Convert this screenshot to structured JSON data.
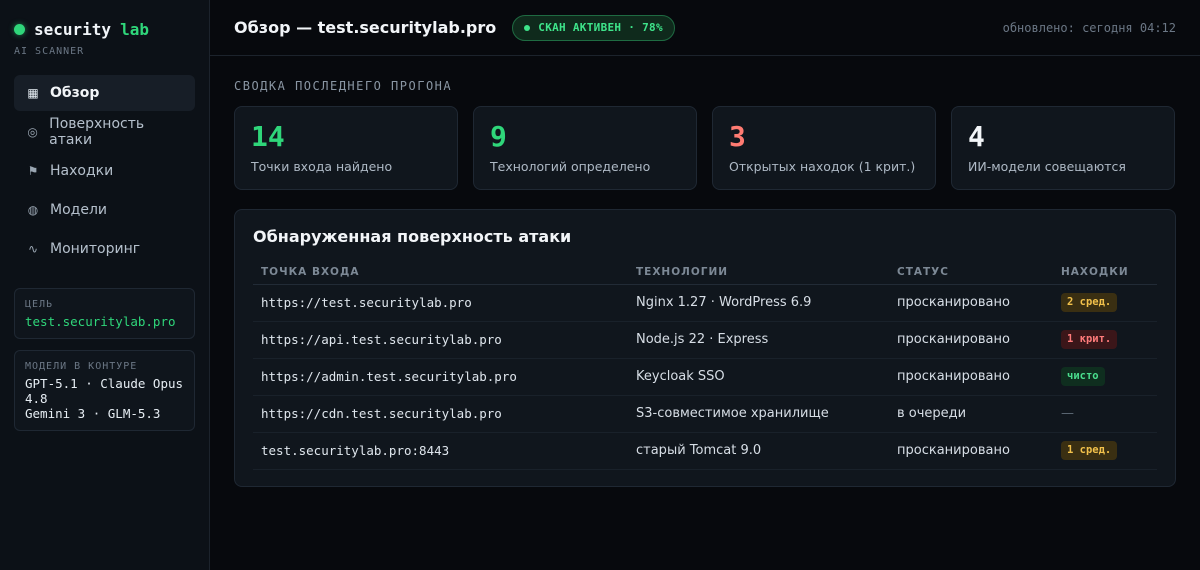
{
  "sidebar": {
    "brand_name": "security",
    "brand_accent": "lab",
    "brand_sub": "AI SCANNER",
    "nav": [
      {
        "label": "Обзор",
        "icon": "grid-icon",
        "active": true
      },
      {
        "label": "Поверхность атаки",
        "icon": "target-icon",
        "active": false
      },
      {
        "label": "Находки",
        "icon": "flag-icon",
        "active": false
      },
      {
        "label": "Модели",
        "icon": "globe-icon",
        "active": false
      },
      {
        "label": "Мониторинг",
        "icon": "pulse-icon",
        "active": false
      }
    ],
    "target_label": "ЦЕЛЬ",
    "target_value": "test.securitylab.pro",
    "models_label": "МОДЕЛИ В КОНТУРЕ",
    "models_line1": "GPT-5.1 · Claude Opus 4.8",
    "models_line2": "Gemini 3 · GLM-5.3"
  },
  "header": {
    "title": "Обзор — test.securitylab.pro",
    "scan_badge": "СКАН АКТИВЕН · 78%",
    "updated": "обновлено: сегодня 04:12"
  },
  "summary": {
    "label": "СВОДКА ПОСЛЕДНЕГО ПРОГОНА",
    "stats": [
      {
        "value": "14",
        "label": "Точки входа найдено",
        "color": "#2fd67a"
      },
      {
        "value": "9",
        "label": "Технологий определено",
        "color": "#2fd67a"
      },
      {
        "value": "3",
        "label": "Открытых находок (1 крит.)",
        "color": "#ff7b72"
      },
      {
        "value": "4",
        "label": "ИИ-модели совещаются",
        "color": "#f2f5f8"
      }
    ]
  },
  "surface": {
    "title": "Обнаруженная поверхность атаки",
    "columns": [
      "ТОЧКА ВХОДА",
      "ТЕХНОЛОГИИ",
      "СТАТУС",
      "НАХОДКИ"
    ],
    "rows": [
      {
        "url": "https://test.securitylab.pro",
        "tech": "Nginx 1.27 · WordPress 6.9",
        "status": "просканировано",
        "finding": "2 сред.",
        "severity": "med"
      },
      {
        "url": "https://api.test.securitylab.pro",
        "tech": "Node.js 22 · Express",
        "status": "просканировано",
        "finding": "1 крит.",
        "severity": "crit"
      },
      {
        "url": "https://admin.test.securitylab.pro",
        "tech": "Keycloak SSO",
        "status": "просканировано",
        "finding": "чисто",
        "severity": "clean"
      },
      {
        "url": "https://cdn.test.securitylab.pro",
        "tech": "S3-совместимое хранилище",
        "status": "в очереди",
        "finding": "—",
        "severity": "none"
      },
      {
        "url": "test.securitylab.pro:8443",
        "tech": "старый Tomcat 9.0",
        "status": "просканировано",
        "finding": "1 сред.",
        "severity": "med"
      }
    ]
  }
}
